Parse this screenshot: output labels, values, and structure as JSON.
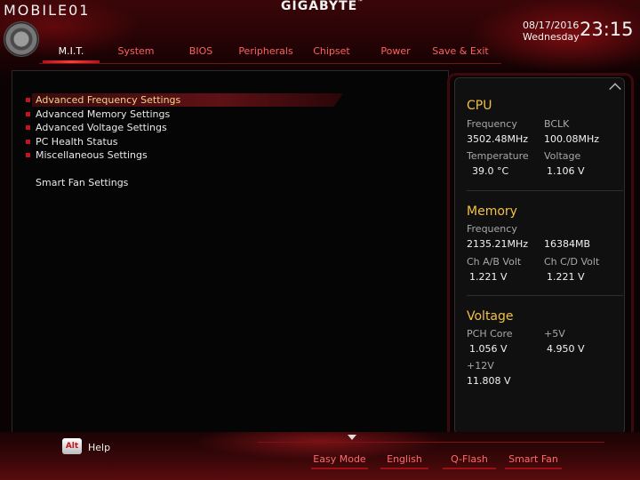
{
  "watermark": "MOBILE01",
  "brand": "GIGABYTE",
  "datetime": {
    "date": "08/17/2016",
    "weekday": "Wednesday",
    "time": "23:15"
  },
  "tabs": [
    {
      "label": "M.I.T.",
      "active": true
    },
    {
      "label": "System",
      "active": false
    },
    {
      "label": "BIOS",
      "active": false
    },
    {
      "label": "Peripherals",
      "active": false
    },
    {
      "label": "Chipset",
      "active": false
    },
    {
      "label": "Power",
      "active": false
    },
    {
      "label": "Save & Exit",
      "active": false
    }
  ],
  "menu": [
    {
      "label": "Advanced Frequency Settings",
      "selected": true
    },
    {
      "label": "Advanced Memory Settings",
      "selected": false
    },
    {
      "label": "Advanced Voltage Settings",
      "selected": false
    },
    {
      "label": "PC Health Status",
      "selected": false
    },
    {
      "label": "Miscellaneous Settings",
      "selected": false
    },
    {
      "label": "Smart Fan Settings",
      "selected": false
    }
  ],
  "info": {
    "cpu": {
      "title": "CPU",
      "frequency_label": "Frequency",
      "frequency_value": "3502.48MHz",
      "bclk_label": "BCLK",
      "bclk_value": "100.08MHz",
      "temperature_label": "Temperature",
      "temperature_value": "39.0 °C",
      "voltage_label": "Voltage",
      "voltage_value": "1.106 V"
    },
    "memory": {
      "title": "Memory",
      "frequency_label": "Frequency",
      "frequency_value": "2135.21MHz",
      "size_value": "16384MB",
      "chab_label": "Ch A/B Volt",
      "chab_value": "1.221 V",
      "chcd_label": "Ch C/D Volt",
      "chcd_value": "1.221 V"
    },
    "voltage": {
      "title": "Voltage",
      "pch_label": "PCH Core",
      "pch_value": "1.056 V",
      "p5v_label": "+5V",
      "p5v_value": "4.950 V",
      "p12v_label": "+12V",
      "p12v_value": "11.808 V"
    }
  },
  "footer": {
    "help_key": "Alt",
    "help_label": "Help",
    "buttons": [
      "Easy Mode",
      "English",
      "Q-Flash",
      "Smart Fan"
    ]
  },
  "colors": {
    "accent": "#c4141c",
    "selected_text": "#f5d28a",
    "section_title": "#f0c14a"
  }
}
